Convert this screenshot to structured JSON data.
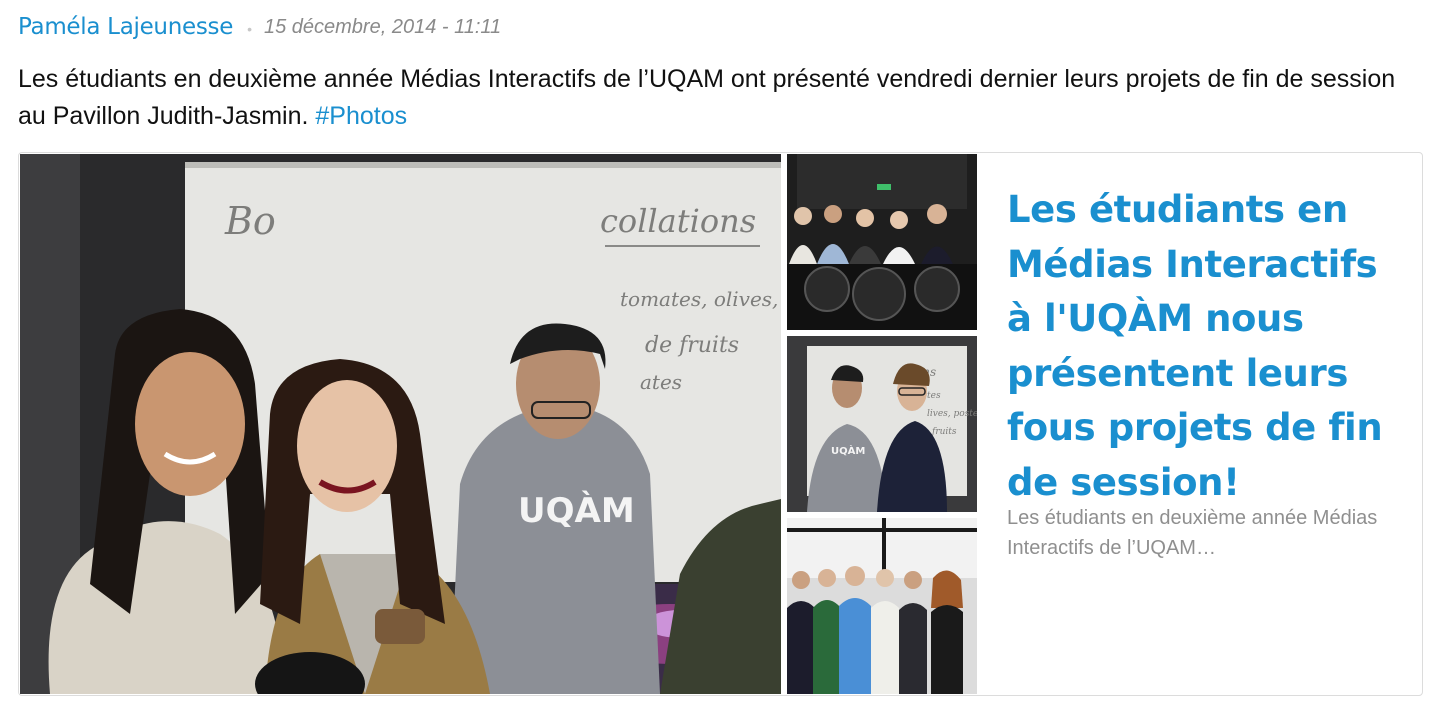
{
  "post": {
    "author": "Paméla Lajeunesse",
    "separator": "•",
    "date": "15 décembre, 2014 - 11:11",
    "text": "Les étudiants en deuxième année Médias Interactifs de l’UQAM ont présenté vendredi dernier leurs projets de fin de session au Pavillon Judith-Jasmin.",
    "hashtag": "#Photos"
  },
  "card": {
    "title": "Les étudiants en Médias Interactifs à l'UQÀM nous présentent leurs fous projets de fin de session!",
    "description": "Les étudiants en deuxième année Médias Interactifs de l’UQAM…",
    "photos": {
      "main": {
        "board_text": "collations",
        "board_list": [
          "tomates, olives, pes",
          "de fruits",
          "ates"
        ],
        "board_corner": "Bo",
        "sweater_text": "UQÀM"
      },
      "thumb2": {
        "board_text": "ons",
        "board_lines": [
          "tes",
          "lives, poste",
          "fruits"
        ],
        "sweater_text": "UQÀM"
      }
    }
  },
  "colors": {
    "link": "#1a8fcf",
    "meta": "#8a8a8a",
    "description": "#8f8f8f",
    "border": "#dcdcdc"
  }
}
